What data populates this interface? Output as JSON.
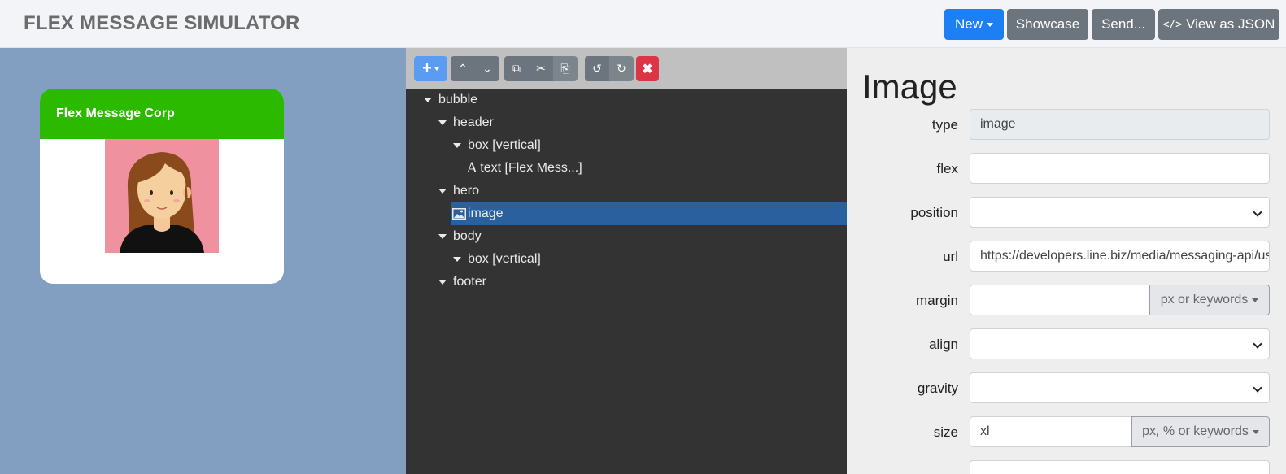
{
  "app": {
    "title": "FLEX MESSAGE SIMULATOR"
  },
  "nav": {
    "new_label": "New",
    "showcase_label": "Showcase",
    "send_label": "Send...",
    "json_label": "View as JSON",
    "json_icon": "</>"
  },
  "preview": {
    "header_text": "Flex Message Corp",
    "header_color": "#2cba00",
    "background_color": "#829fc1"
  },
  "toolbar": {
    "add_icon": "+",
    "up_icon": "⌃",
    "down_icon": "⌄",
    "copy_icon": "⧉",
    "cut_icon": "✂",
    "paste_icon": "⎘",
    "undo_icon": "↺",
    "redo_icon": "↻",
    "delete_icon": "✖"
  },
  "tree": {
    "items": [
      {
        "label": "bubble"
      },
      {
        "label": "header"
      },
      {
        "label": "box [vertical]"
      },
      {
        "label": "text [Flex Mess...]"
      },
      {
        "label": "hero"
      },
      {
        "label": "image",
        "selected": true
      },
      {
        "label": "body"
      },
      {
        "label": "box [vertical]"
      },
      {
        "label": "footer"
      }
    ]
  },
  "props": {
    "title": "Image",
    "fields": [
      {
        "label": "type",
        "value": "image"
      },
      {
        "label": "flex",
        "value": ""
      },
      {
        "label": "position",
        "value": ""
      },
      {
        "label": "url",
        "value": "https://developers.line.biz/media/messaging-api/using-flex-message-to-send-messages/flex-message-simulator/avatar.png"
      },
      {
        "label": "margin",
        "value": "",
        "unit": "px or keywords"
      },
      {
        "label": "align",
        "value": ""
      },
      {
        "label": "gravity",
        "value": ""
      },
      {
        "label": "size",
        "value": "xl",
        "unit": "px, % or keywords"
      }
    ]
  }
}
